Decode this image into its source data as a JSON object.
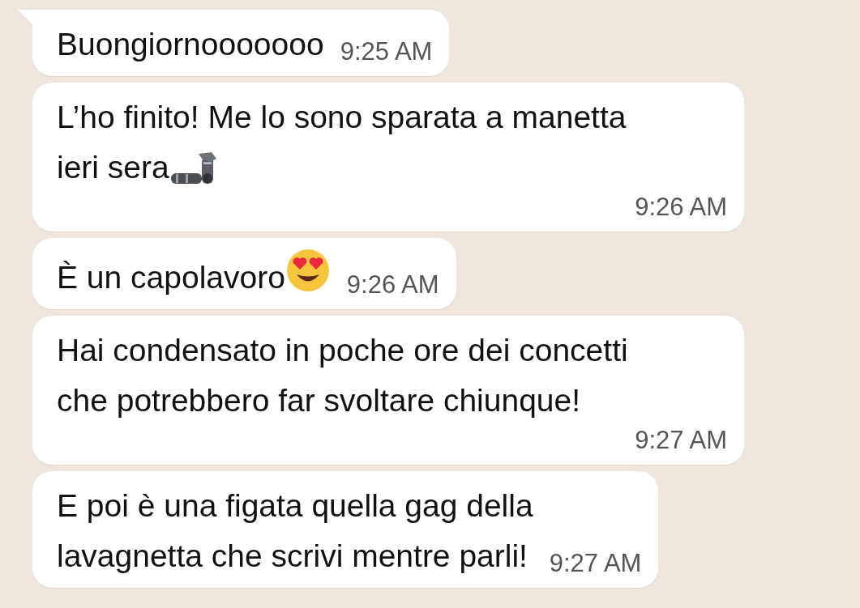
{
  "messages": [
    {
      "lines": [
        "Buongiornooooooo"
      ],
      "time": "9:25 AM",
      "has_tail": true
    },
    {
      "lines": [
        "L’ho finito! Me lo sono sparata a manetta",
        "ieri sera"
      ],
      "time": "9:26 AM",
      "has_tail": false,
      "kind": "with_mechanical_arm"
    },
    {
      "lines": [
        "È un capolavoro"
      ],
      "time": "9:26 AM",
      "has_tail": false,
      "kind": "with_heart_eyes"
    },
    {
      "lines": [
        "Hai condensato in poche ore dei concetti",
        "che potrebbero far svoltare chiunque!"
      ],
      "time": "9:27 AM",
      "has_tail": false
    },
    {
      "lines": [
        "E poi è una figata quella gag della",
        "lavagnetta che scrivi mentre parli!"
      ],
      "time": "9:27 AM",
      "has_tail": false
    }
  ]
}
